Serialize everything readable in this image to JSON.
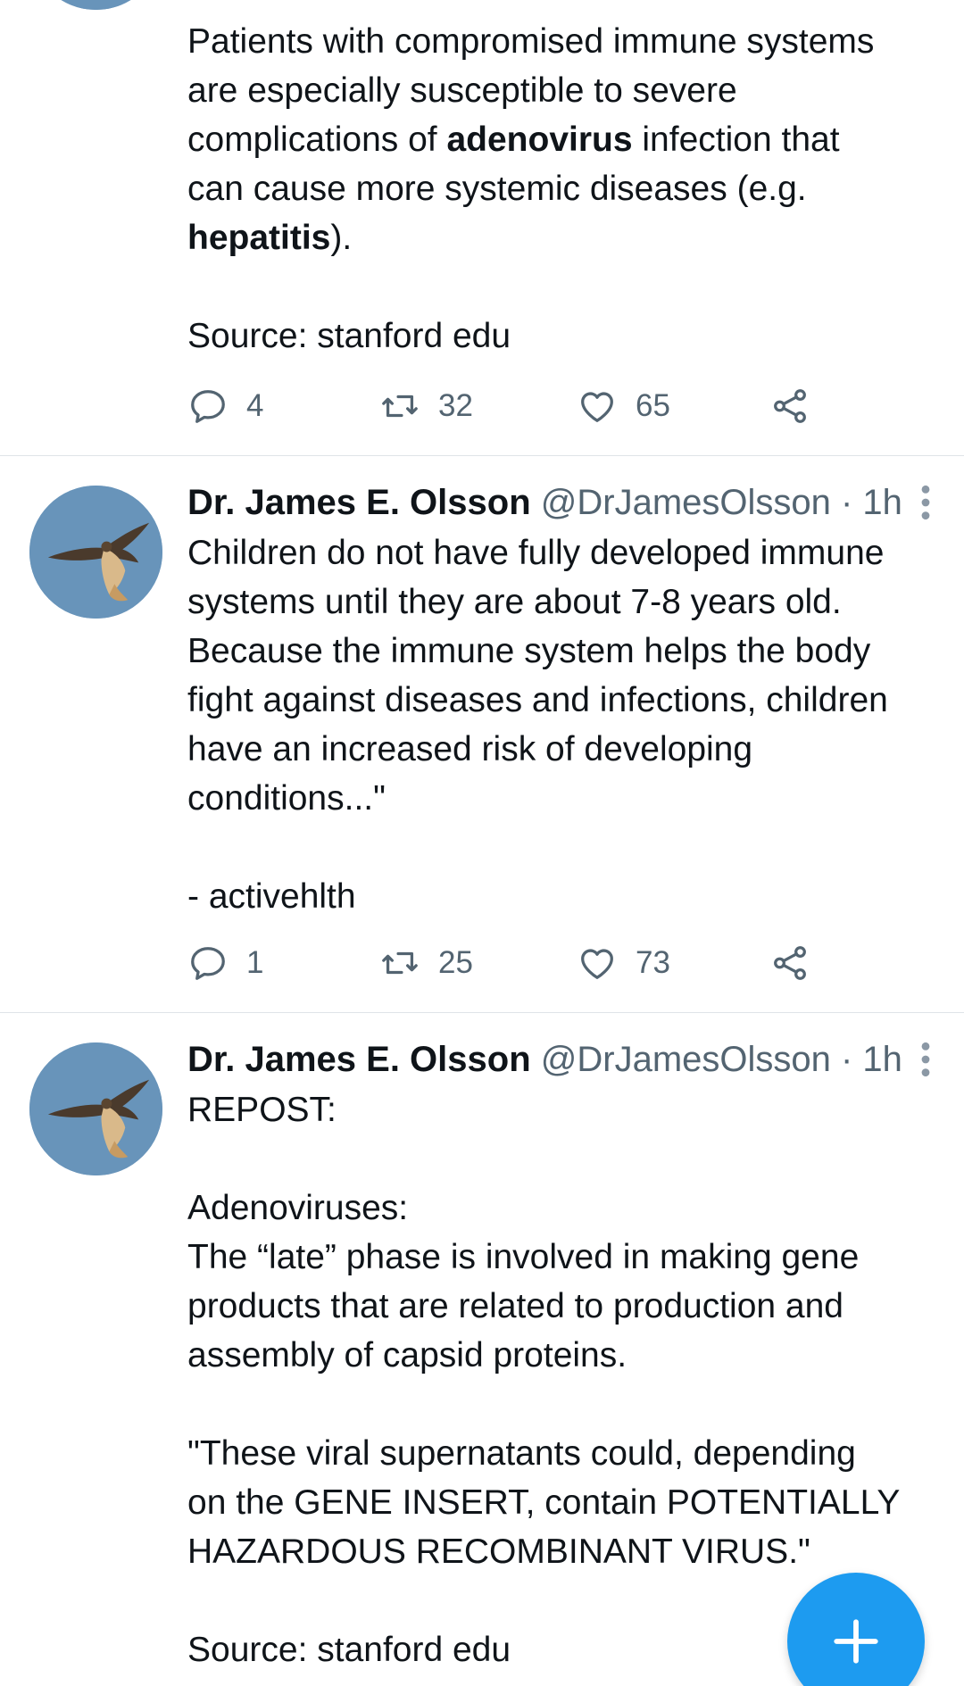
{
  "colors": {
    "text": "#0f1419",
    "secondary": "#536471",
    "divider": "#dfe4e8",
    "accent": "#1d9bf0"
  },
  "tweets": [
    {
      "body_pre1": "Patients with compromised immune systems\nare especially susceptible to severe\ncomplications of ",
      "bold1": "adenovirus",
      "body_mid": " infection that\ncan cause more systemic diseases (e.g.\n",
      "bold2": "hepatitis",
      "body_post": ").\n\nSource: stanford edu",
      "replies": "4",
      "retweets": "32",
      "likes": "65"
    },
    {
      "name": "Dr. James E. Olsson",
      "handle": "@DrJamesOlsson · 1h",
      "body": "Children do not have fully developed immune\nsystems until they are about 7-8 years old.\nBecause the immune system helps the body\nfight against diseases and infections, children\nhave an increased risk of developing\nconditions...\"\n\n- activehlth",
      "replies": "1",
      "retweets": "25",
      "likes": "73"
    },
    {
      "name": "Dr. James E. Olsson",
      "handle": "@DrJamesOlsson · 1h",
      "body": "REPOST:\n\nAdenoviruses:\nThe “late” phase is involved in making gene\nproducts that are related to production and\nassembly of capsid proteins.\n\n\"These viral supernatants could, depending\non the GENE INSERT, contain POTENTIALLY\nHAZARDOUS RECOMBINANT VIRUS.\"\n\nSource: stanford edu"
    }
  ],
  "icons": {
    "reply": "reply-icon",
    "retweet": "retweet-icon",
    "like": "heart-icon",
    "share": "share-icon",
    "more": "more-vertical-icon",
    "compose": "plus-icon"
  }
}
